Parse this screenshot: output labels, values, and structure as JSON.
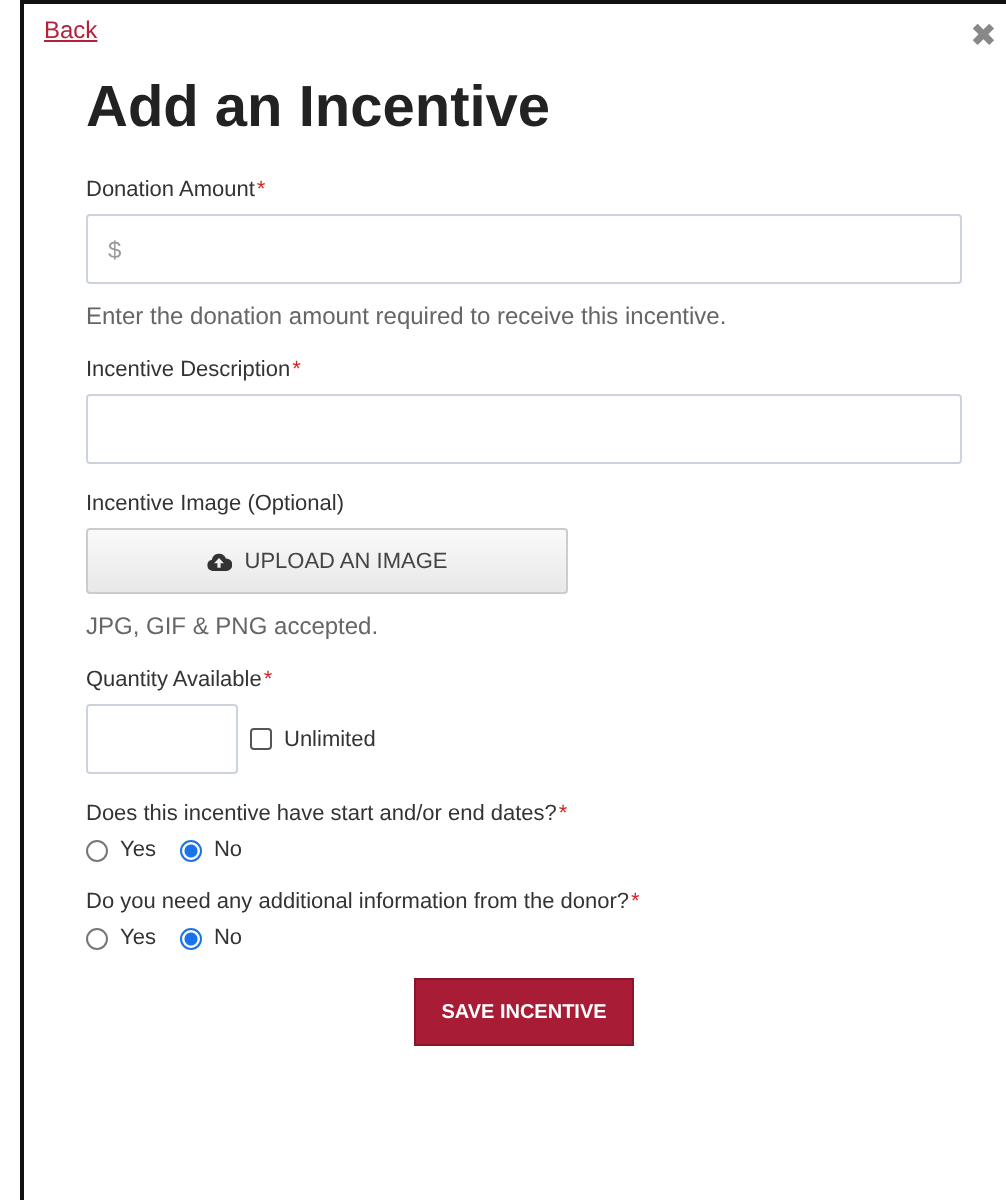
{
  "back_link": "Back",
  "close": "✖",
  "title": "Add an Incentive",
  "fields": [
    {
      "kind": "text",
      "label": "Donation Amount",
      "required_mark": "*",
      "placeholder": "$",
      "help": "Enter the donation amount required to receive this incentive."
    },
    {
      "kind": "text",
      "label": "Incentive Description",
      "required_mark": "*"
    },
    {
      "kind": "upload",
      "label": "Incentive Image (Optional)",
      "button": "UPLOAD AN IMAGE",
      "help": "JPG, GIF & PNG accepted."
    },
    {
      "kind": "quantity",
      "label": "Quantity Available",
      "required_mark": "*",
      "checkbox": {
        "label": "Unlimited",
        "checked": false
      }
    },
    {
      "kind": "radio",
      "label": "Does this incentive have start and/or end dates?",
      "required_mark": "*",
      "options": [
        {
          "label": "Yes",
          "selected": false
        },
        {
          "label": "No",
          "selected": true
        }
      ]
    },
    {
      "kind": "radio",
      "label": "Do you need any additional information from the donor?",
      "required_mark": "*",
      "options": [
        {
          "label": "Yes",
          "selected": false
        },
        {
          "label": "No",
          "selected": true
        }
      ]
    }
  ],
  "save_button": "SAVE INCENTIVE"
}
